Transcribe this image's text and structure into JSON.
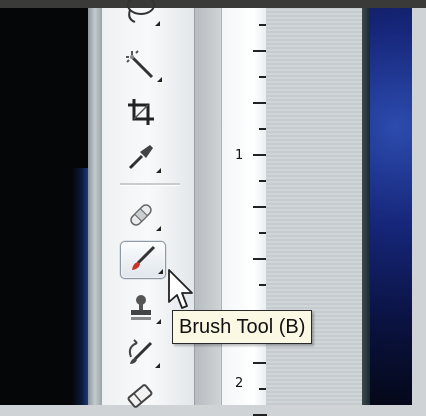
{
  "tooltip": {
    "text": "Brush Tool (B)"
  },
  "ruler": {
    "labels": [
      "1",
      "2"
    ]
  },
  "toolbar": {
    "tools": [
      {
        "name": "lasso-tool",
        "icon": "lasso-icon"
      },
      {
        "name": "magic-wand-tool",
        "icon": "magic-wand-icon"
      },
      {
        "name": "crop-tool",
        "icon": "crop-icon"
      },
      {
        "name": "eyedropper-tool",
        "icon": "eyedropper-icon"
      },
      {
        "name": "healing-brush-tool",
        "icon": "bandage-icon"
      },
      {
        "name": "brush-tool",
        "icon": "brush-icon",
        "selected": true
      },
      {
        "name": "clone-stamp-tool",
        "icon": "stamp-icon"
      },
      {
        "name": "history-brush-tool",
        "icon": "history-brush-icon"
      },
      {
        "name": "eraser-tool",
        "icon": "eraser-icon"
      }
    ]
  },
  "colors": {
    "tooltip_bg": "#fbf9e4",
    "accent_brush_tip": "#c8332a"
  }
}
